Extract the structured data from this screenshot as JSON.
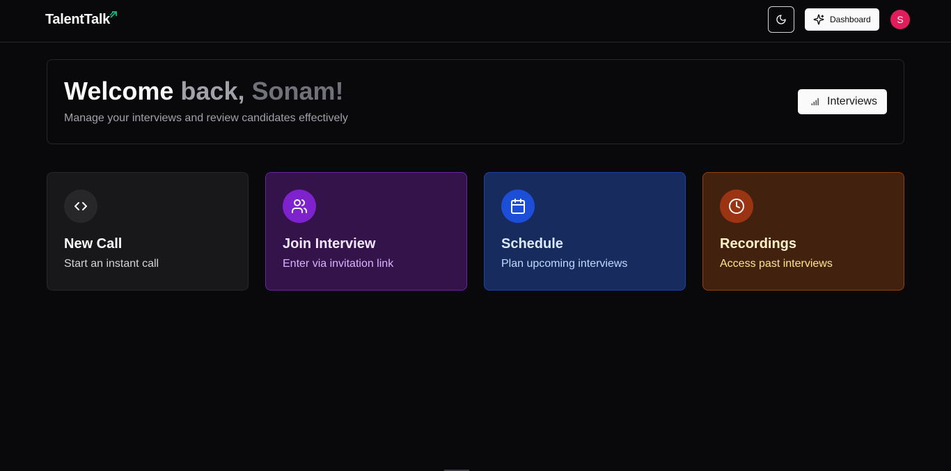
{
  "header": {
    "logo_text": "TalentTalk",
    "theme_icon": "moon-icon",
    "dashboard_label": "Dashboard",
    "dashboard_icon": "sparkles-icon",
    "avatar_initial": "S"
  },
  "welcome": {
    "title_part1": "Welcome",
    "title_part2": "back,",
    "title_part3": "Sonam!",
    "subtitle": "Manage your interviews and review candidates effectively",
    "interviews_label": "Interviews",
    "interviews_icon": "bar-chart-icon"
  },
  "cards": [
    {
      "title": "New Call",
      "subtitle": "Start an instant call",
      "icon": "code-icon",
      "accent": "#27272a"
    },
    {
      "title": "Join Interview",
      "subtitle": "Enter via invitation link",
      "icon": "users-icon",
      "accent": "#7e22ce"
    },
    {
      "title": "Schedule",
      "subtitle": "Plan upcoming interviews",
      "icon": "calendar-icon",
      "accent": "#1d4ed8"
    },
    {
      "title": "Recordings",
      "subtitle": "Access past interviews",
      "icon": "clock-icon",
      "accent": "#9a3412"
    }
  ],
  "colors": {
    "background": "#09090b",
    "logo_accent": "#10b981",
    "avatar": "#e11d5b"
  }
}
